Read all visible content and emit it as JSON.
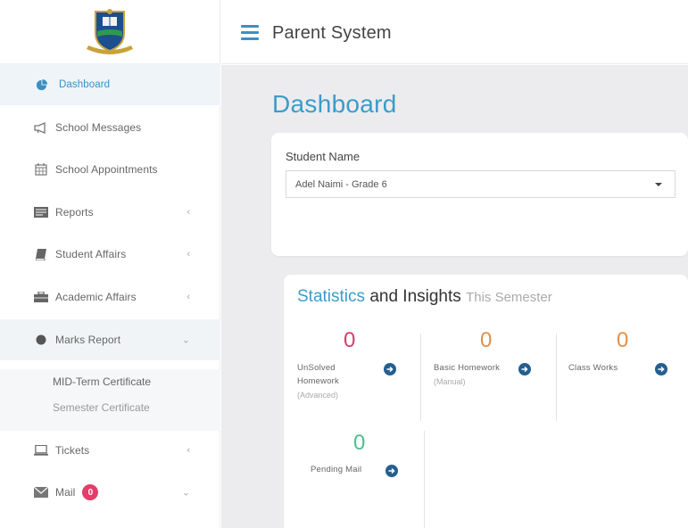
{
  "header": {
    "title": "Parent System"
  },
  "sidebar": {
    "items": [
      {
        "label": "Dashboard",
        "icon": "pie-chart-icon"
      },
      {
        "label": "School Messages",
        "icon": "megaphone-icon"
      },
      {
        "label": "School Appointments",
        "icon": "calendar-icon"
      },
      {
        "label": "Reports",
        "icon": "report-icon",
        "chevron": "‹"
      },
      {
        "label": "Student Affairs",
        "icon": "book-icon",
        "chevron": "‹"
      },
      {
        "label": "Academic Affairs",
        "icon": "briefcase-icon",
        "chevron": "‹"
      },
      {
        "label": "Marks Report",
        "icon": "circle-icon",
        "chevron": "⌄"
      },
      {
        "label": "Tickets",
        "icon": "laptop-icon",
        "chevron": "‹"
      },
      {
        "label": "Mail",
        "icon": "envelope-icon",
        "chevron": "⌄",
        "badge": "0"
      }
    ],
    "sub_items": [
      "MID-Term Certificate",
      "Semester Certificate"
    ]
  },
  "main": {
    "page_title": "Dashboard",
    "student": {
      "label": "Student Name",
      "selected": "Adel Naimi - Grade 6"
    },
    "stats": {
      "title_part1": "Statistics",
      "title_part2": "and Insights",
      "title_part3": "This Semester",
      "items": [
        {
          "value": "0",
          "label_line1": "UnSolved",
          "label_line2": "Homework",
          "sub": "(Advanced)",
          "color": "#d63d6c"
        },
        {
          "value": "0",
          "label_line1": "Basic Homework",
          "label_line2": "",
          "sub": "(Manual)",
          "color": "#e3904a"
        },
        {
          "value": "0",
          "label_line1": "Class Works",
          "label_line2": "",
          "sub": "",
          "color": "#e3904a"
        },
        {
          "value": "0",
          "label_line1": "Pending Mail",
          "label_line2": "",
          "sub": "",
          "color": "#4cbf8f"
        }
      ]
    }
  },
  "colors": {
    "accent": "#3b9cc9",
    "dark_blue": "#245f8f",
    "badge": "#e03f6a",
    "background": "#ececee"
  }
}
